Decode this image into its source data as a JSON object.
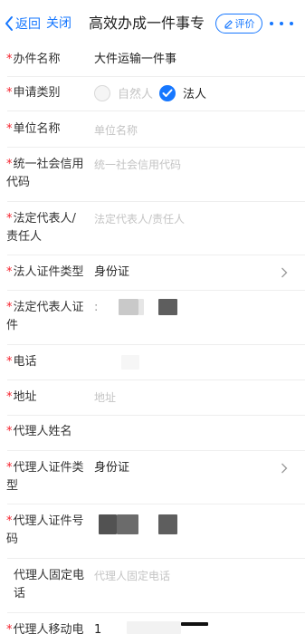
{
  "nav": {
    "back_label": "返回",
    "close_label": "关闭",
    "title": "高效办成一件事专",
    "review_label": "评价",
    "accent": "#1677ff"
  },
  "form": {
    "required_mark": "*",
    "fields": [
      {
        "label": "办件名称",
        "value": "大件运输一件事"
      },
      {
        "label": "申请类别",
        "options": [
          "自然人",
          "法人"
        ],
        "selected": "法人"
      },
      {
        "label": "单位名称",
        "placeholder": "单位名称"
      },
      {
        "label_line1": "统一社会信用",
        "label_line2": "代码",
        "placeholder": "统一社会信用代码"
      },
      {
        "label_line1": "法定代表人/",
        "label_line2": "责任人",
        "placeholder": "法定代表人/责任人"
      },
      {
        "label": "法人证件类型",
        "value": "身份证"
      },
      {
        "label_line1": "法定代表人证",
        "label_line2": "件",
        "value_prefix": ":"
      },
      {
        "label": "电话"
      },
      {
        "label": "地址",
        "placeholder": "地址"
      },
      {
        "label": "代理人姓名"
      },
      {
        "label_line1": "代理人证件类",
        "label_line2": "型",
        "value": "身份证"
      },
      {
        "label_line1": "代理人证件号",
        "label_line2": "码"
      },
      {
        "label_line1": "代理人固定电",
        "label_line2": "话",
        "placeholder": "代理人固定电话"
      },
      {
        "label": "代理人移动电",
        "value_prefix": "1"
      }
    ]
  }
}
